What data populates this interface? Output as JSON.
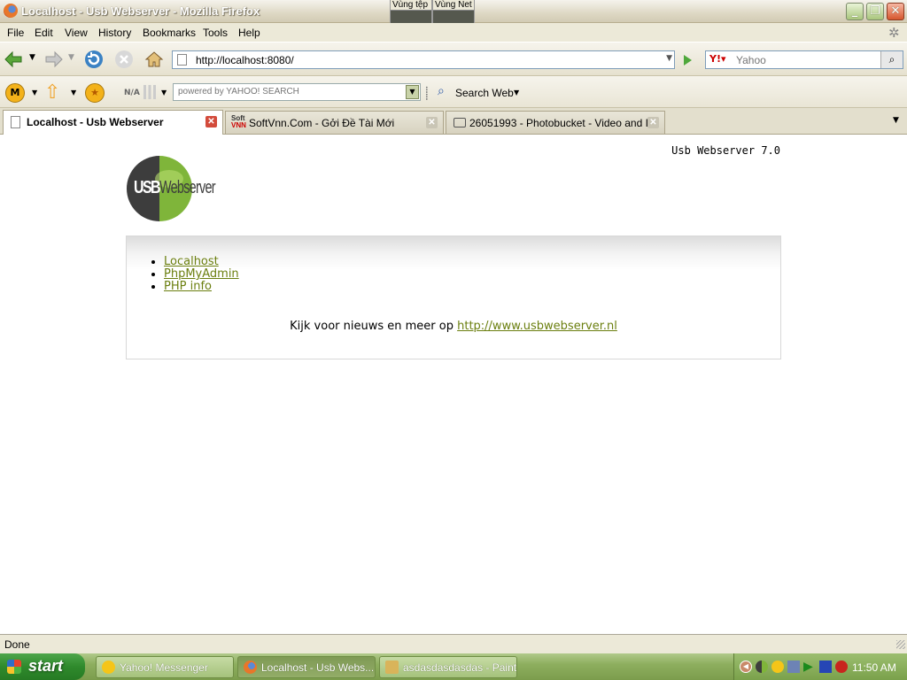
{
  "window": {
    "title": "Localhost - Usb Webserver - Mozilla Firefox",
    "popups": [
      "Vùng tệp",
      "Vùng Net"
    ]
  },
  "menu": [
    "File",
    "Edit",
    "View",
    "History",
    "Bookmarks",
    "Tools",
    "Help"
  ],
  "nav": {
    "url": "http://localhost:8080/",
    "search_placeholder": "Yahoo"
  },
  "yahoo_toolbar": {
    "search_placeholder": "powered by YAHOO! SEARCH",
    "na_label": "N/A",
    "search_web_label": "Search Web"
  },
  "tabs": [
    {
      "label": "Localhost - Usb Webserver",
      "active": true
    },
    {
      "label": "SoftVnn.Com - Gởi Đề Tài Mới",
      "active": false
    },
    {
      "label": "26051993 - Photobucket - Video and I...",
      "active": false
    }
  ],
  "page": {
    "version": "Usb Webserver 7.0",
    "logo_usb": "USB",
    "logo_web": "Webserver",
    "links": [
      "Localhost",
      "PhpMyAdmin",
      "PHP info"
    ],
    "news_prefix": "Kijk voor nieuws en meer op ",
    "news_link": "http://www.usbwebserver.nl"
  },
  "status": "Done",
  "taskbar": {
    "start": "start",
    "tasks": [
      {
        "label": "Yahoo! Messenger",
        "active": false
      },
      {
        "label": "Localhost - Usb Webs...",
        "active": true
      },
      {
        "label": "asdasdasdasdas - Paint",
        "active": false
      }
    ],
    "clock": "11:50 AM"
  },
  "colors": {
    "link": "#6b7f0f",
    "logo_green": "#7fb53a",
    "logo_dark": "#3d3d3d"
  }
}
